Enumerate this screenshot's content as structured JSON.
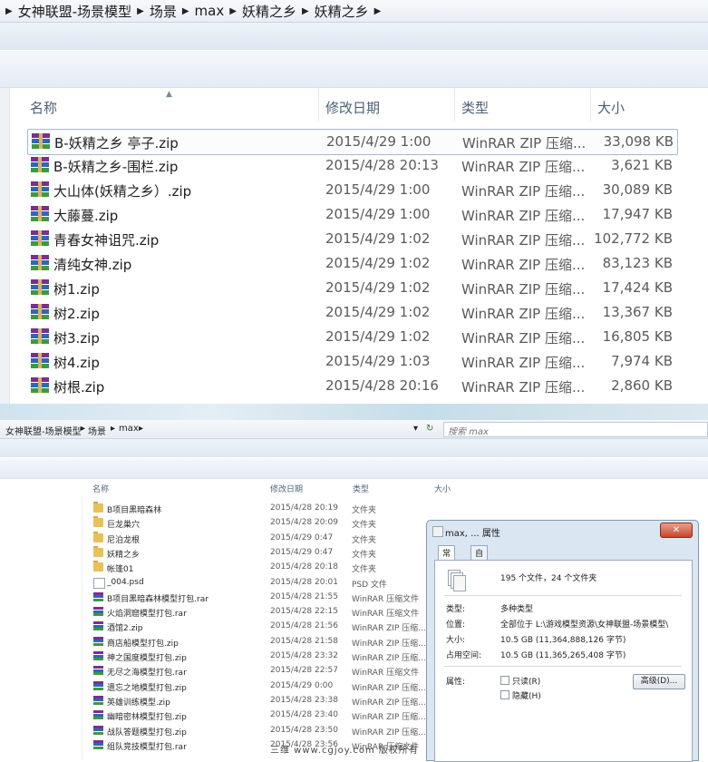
{
  "top": {
    "breadcrumb": [
      "女神联盟-场景模型",
      "场景",
      "max",
      "妖精之乡",
      "妖精之乡"
    ],
    "columns": {
      "name": "名称",
      "date": "修改日期",
      "type": "类型",
      "size": "大小"
    },
    "files": [
      {
        "name": "B-妖精之乡   亭子.zip",
        "date": "2015/4/29 1:00",
        "type": "WinRAR ZIP 压缩...",
        "size": "33,098 KB"
      },
      {
        "name": "B-妖精之乡-围栏.zip",
        "date": "2015/4/28 20:13",
        "type": "WinRAR ZIP 压缩...",
        "size": "3,621 KB"
      },
      {
        "name": "大山体(妖精之乡）.zip",
        "date": "2015/4/29 1:00",
        "type": "WinRAR ZIP 压缩...",
        "size": "30,089 KB"
      },
      {
        "name": "大藤蔓.zip",
        "date": "2015/4/29 1:00",
        "type": "WinRAR ZIP 压缩...",
        "size": "17,947 KB"
      },
      {
        "name": "青春女神诅咒.zip",
        "date": "2015/4/29 1:02",
        "type": "WinRAR ZIP 压缩...",
        "size": "102,772 KB"
      },
      {
        "name": "清纯女神.zip",
        "date": "2015/4/29 1:02",
        "type": "WinRAR ZIP 压缩...",
        "size": "83,123 KB"
      },
      {
        "name": "树1.zip",
        "date": "2015/4/29 1:02",
        "type": "WinRAR ZIP 压缩...",
        "size": "17,424 KB"
      },
      {
        "name": "树2.zip",
        "date": "2015/4/29 1:02",
        "type": "WinRAR ZIP 压缩...",
        "size": "13,367 KB"
      },
      {
        "name": "树3.zip",
        "date": "2015/4/29 1:02",
        "type": "WinRAR ZIP 压缩...",
        "size": "16,805 KB"
      },
      {
        "name": "树4.zip",
        "date": "2015/4/29 1:03",
        "type": "WinRAR ZIP 压缩...",
        "size": "7,974 KB"
      },
      {
        "name": "树根.zip",
        "date": "2015/4/28 20:16",
        "type": "WinRAR ZIP 压缩...",
        "size": "2,860 KB"
      }
    ]
  },
  "bottom": {
    "breadcrumb": [
      "女神联盟-场景模型",
      "场景",
      "max"
    ],
    "search_placeholder": "搜索 max",
    "columns": {
      "name": "名称",
      "date": "修改日期",
      "type": "类型",
      "size": "大小"
    },
    "items": [
      {
        "kind": "folder",
        "name": "B项目黑暗森林",
        "date": "2015/4/28 20:19",
        "type": "文件夹"
      },
      {
        "kind": "folder",
        "name": "巨龙巢穴",
        "date": "2015/4/28 20:09",
        "type": "文件夹"
      },
      {
        "kind": "folder",
        "name": "尼泊龙根",
        "date": "2015/4/29 0:47",
        "type": "文件夹"
      },
      {
        "kind": "folder",
        "name": "妖精之乡",
        "date": "2015/4/29 0:47",
        "type": "文件夹"
      },
      {
        "kind": "folder",
        "name": "帐篷01",
        "date": "2015/4/28 20:18",
        "type": "文件夹"
      },
      {
        "kind": "psd",
        "name": "_004.psd",
        "date": "2015/4/28 20:01",
        "type": "PSD 文件"
      },
      {
        "kind": "rar",
        "name": "B项目黑暗森林模型打包.rar",
        "date": "2015/4/28 21:55",
        "type": "WinRAR 压缩文件"
      },
      {
        "kind": "rar",
        "name": "火焰洞窟模型打包.rar",
        "date": "2015/4/28 22:15",
        "type": "WinRAR 压缩文件"
      },
      {
        "kind": "rar",
        "name": "酒馆2.zip",
        "date": "2015/4/28 21:56",
        "type": "WinRAR ZIP 压缩..."
      },
      {
        "kind": "rar",
        "name": "商店船模型打包.zip",
        "date": "2015/4/28 21:58",
        "type": "WinRAR ZIP 压缩..."
      },
      {
        "kind": "rar",
        "name": "神之国度模型打包.zip",
        "date": "2015/4/28 23:32",
        "type": "WinRAR ZIP 压缩..."
      },
      {
        "kind": "rar",
        "name": "无尽之海模型打包.rar",
        "date": "2015/4/28 22:57",
        "type": "WinRAR 压缩文件"
      },
      {
        "kind": "rar",
        "name": "遗忘之地模型打包.zip",
        "date": "2015/4/29 0:00",
        "type": "WinRAR ZIP 压缩..."
      },
      {
        "kind": "rar",
        "name": "英雄训练模型.zip",
        "date": "2015/4/28 23:38",
        "type": "WinRAR ZIP 压缩..."
      },
      {
        "kind": "rar",
        "name": "幽暗密林模型打包.zip",
        "date": "2015/4/28 23:40",
        "type": "WinRAR ZIP 压缩..."
      },
      {
        "kind": "rar",
        "name": "战队答题模型打包.zip",
        "date": "2015/4/28 23:50",
        "type": "WinRAR ZIP 压缩..."
      },
      {
        "kind": "rar",
        "name": "组队竞技模型打包.rar",
        "date": "2015/4/28 23:56",
        "type": "WinRAR 压缩文件"
      }
    ]
  },
  "dialog": {
    "title": "max, ... 属性",
    "close": "✕",
    "tabs": [
      "常规",
      "自定义"
    ],
    "summary": "195 个文件，24 个文件夹",
    "type_label": "类型:",
    "type_value": "多种类型",
    "location_label": "位置:",
    "location_value": "全部位于 L:\\游戏模型资源\\女神联盟-场景模型\\",
    "size_label": "大小:",
    "size_value": "10.5 GB (11,364,888,126 字节)",
    "disk_label": "占用空间:",
    "disk_value": "10.5 GB (11,365,265,408 字节)",
    "attr_label": "属性:",
    "readonly_label": "只读(R)",
    "hidden_label": "隐藏(H)",
    "advanced_button": "高级(D)..."
  },
  "watermark": "三维 www.cgjoy.com 版权所有"
}
